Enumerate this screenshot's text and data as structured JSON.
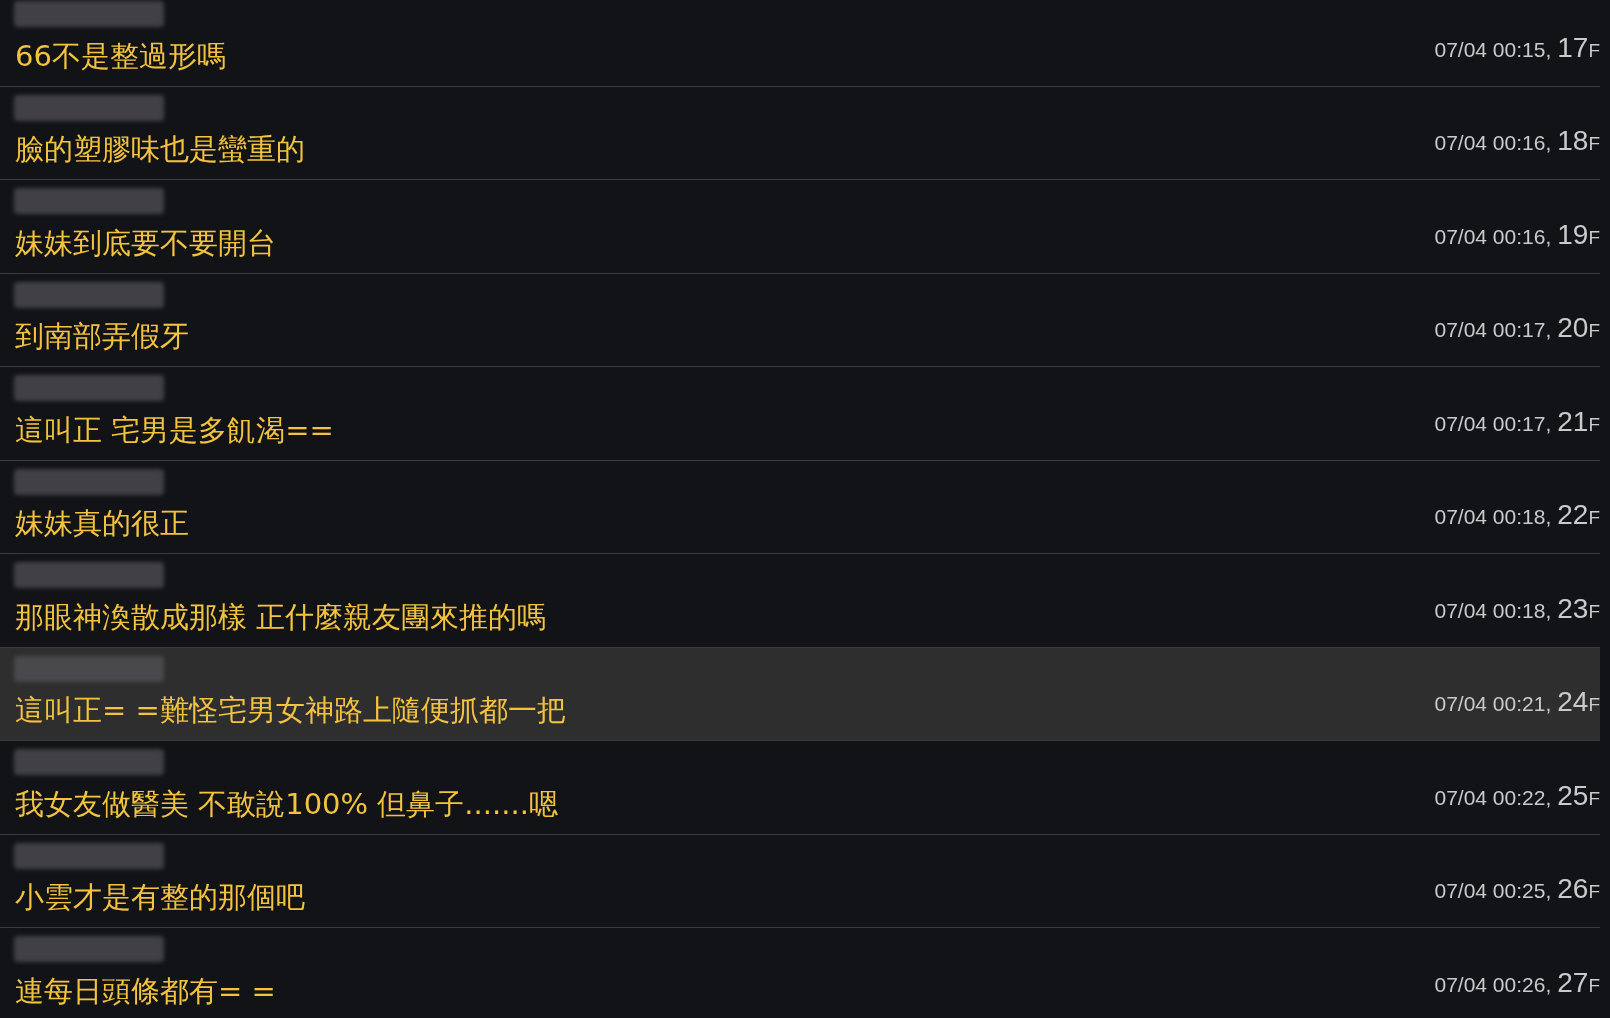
{
  "comments": [
    {
      "text": "66不是整過形嗎",
      "time": "07/04 00:15,",
      "floor": "17",
      "floor_suffix": "F",
      "selected": false
    },
    {
      "text": "臉的塑膠味也是蠻重的",
      "time": "07/04 00:16,",
      "floor": "18",
      "floor_suffix": "F",
      "selected": false
    },
    {
      "text": "妹妹到底要不要開台",
      "time": "07/04 00:16,",
      "floor": "19",
      "floor_suffix": "F",
      "selected": false
    },
    {
      "text": "到南部弄假牙",
      "time": "07/04 00:17,",
      "floor": "20",
      "floor_suffix": "F",
      "selected": false
    },
    {
      "text": "這叫正 宅男是多飢渴==",
      "time": "07/04 00:17,",
      "floor": "21",
      "floor_suffix": "F",
      "selected": false
    },
    {
      "text": "妹妹真的很正",
      "time": "07/04 00:18,",
      "floor": "22",
      "floor_suffix": "F",
      "selected": false
    },
    {
      "text": "那眼神渙散成那樣 正什麼親友團來推的嗎",
      "time": "07/04 00:18,",
      "floor": "23",
      "floor_suffix": "F",
      "selected": false
    },
    {
      "text": "這叫正= =難怪宅男女神路上隨便抓都一把",
      "time": "07/04 00:21,",
      "floor": "24",
      "floor_suffix": "F",
      "selected": true
    },
    {
      "text": "我女友做醫美 不敢說100% 但鼻子.......嗯",
      "time": "07/04 00:22,",
      "floor": "25",
      "floor_suffix": "F",
      "selected": false
    },
    {
      "text": "小雲才是有整的那個吧",
      "time": "07/04 00:25,",
      "floor": "26",
      "floor_suffix": "F",
      "selected": false
    },
    {
      "text": "連每日頭條都有= =",
      "time": "07/04 00:26,",
      "floor": "27",
      "floor_suffix": "F",
      "selected": false
    }
  ]
}
